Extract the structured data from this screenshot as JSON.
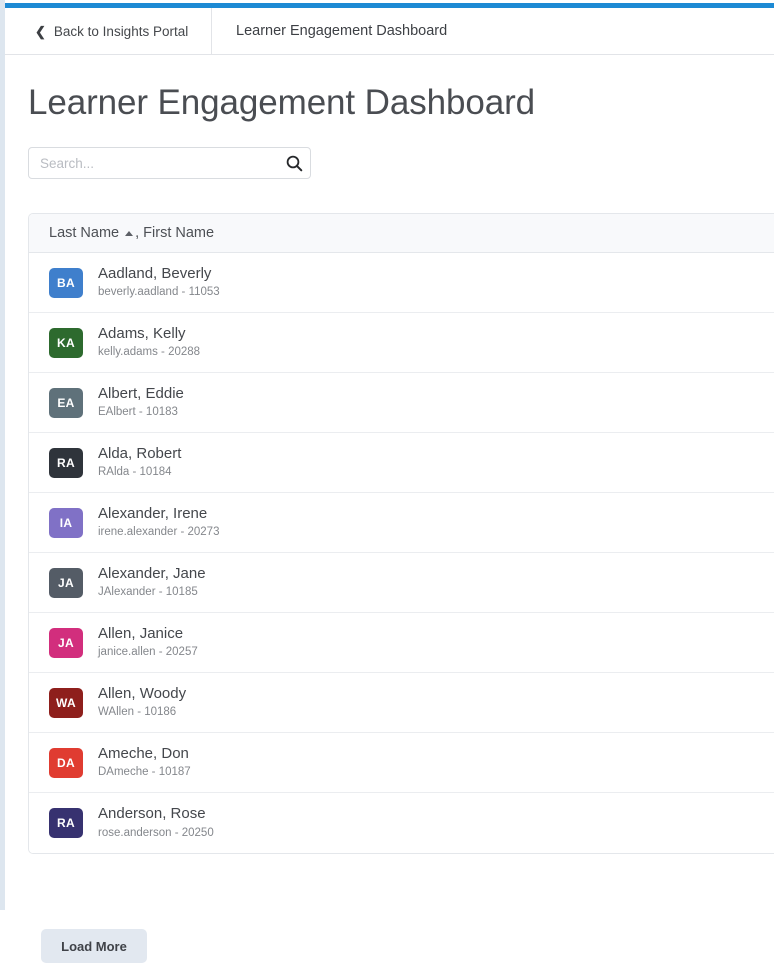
{
  "theme": {
    "accent_bar_color": "#1d8ad4",
    "gutter_color": "#dde6ef",
    "header_row_bg": "#f8f9fb",
    "button_bg": "#e2e8f0"
  },
  "navbar": {
    "back_icon": "chevron-left-icon",
    "back_label": "Back to Insights Portal",
    "title": "Learner Engagement Dashboard"
  },
  "page": {
    "title": "Learner Engagement Dashboard"
  },
  "search": {
    "value": "",
    "placeholder": "Search...",
    "icon": "search-icon"
  },
  "list": {
    "header": {
      "primary_label": "Last Name",
      "sort_icon": "sort-ascending-caret-icon",
      "secondary_label": ", First Name"
    },
    "rows": [
      {
        "initials": "BA",
        "color": "#3f7fcc",
        "name": "Aadland, Beverly",
        "sub": "beverly.aadland - 11053"
      },
      {
        "initials": "KA",
        "color": "#2d6a2e",
        "name": "Adams, Kelly",
        "sub": "kelly.adams - 20288"
      },
      {
        "initials": "EA",
        "color": "#5f717a",
        "name": "Albert, Eddie",
        "sub": "EAlbert - 10183"
      },
      {
        "initials": "RA",
        "color": "#2f343b",
        "name": "Alda, Robert",
        "sub": "RAlda - 10184"
      },
      {
        "initials": "IA",
        "color": "#8071c6",
        "name": "Alexander, Irene",
        "sub": "irene.alexander - 20273"
      },
      {
        "initials": "JA",
        "color": "#545c66",
        "name": "Alexander, Jane",
        "sub": "JAlexander - 10185"
      },
      {
        "initials": "JA",
        "color": "#d22e7d",
        "name": "Allen, Janice",
        "sub": "janice.allen - 20257"
      },
      {
        "initials": "WA",
        "color": "#8e1f1c",
        "name": "Allen, Woody",
        "sub": "WAllen - 10186"
      },
      {
        "initials": "DA",
        "color": "#e03c31",
        "name": "Ameche, Don",
        "sub": "DAmeche - 10187"
      },
      {
        "initials": "RA",
        "color": "#373270",
        "name": "Anderson, Rose",
        "sub": "rose.anderson - 20250"
      }
    ]
  },
  "footer": {
    "load_more_label": "Load More"
  }
}
